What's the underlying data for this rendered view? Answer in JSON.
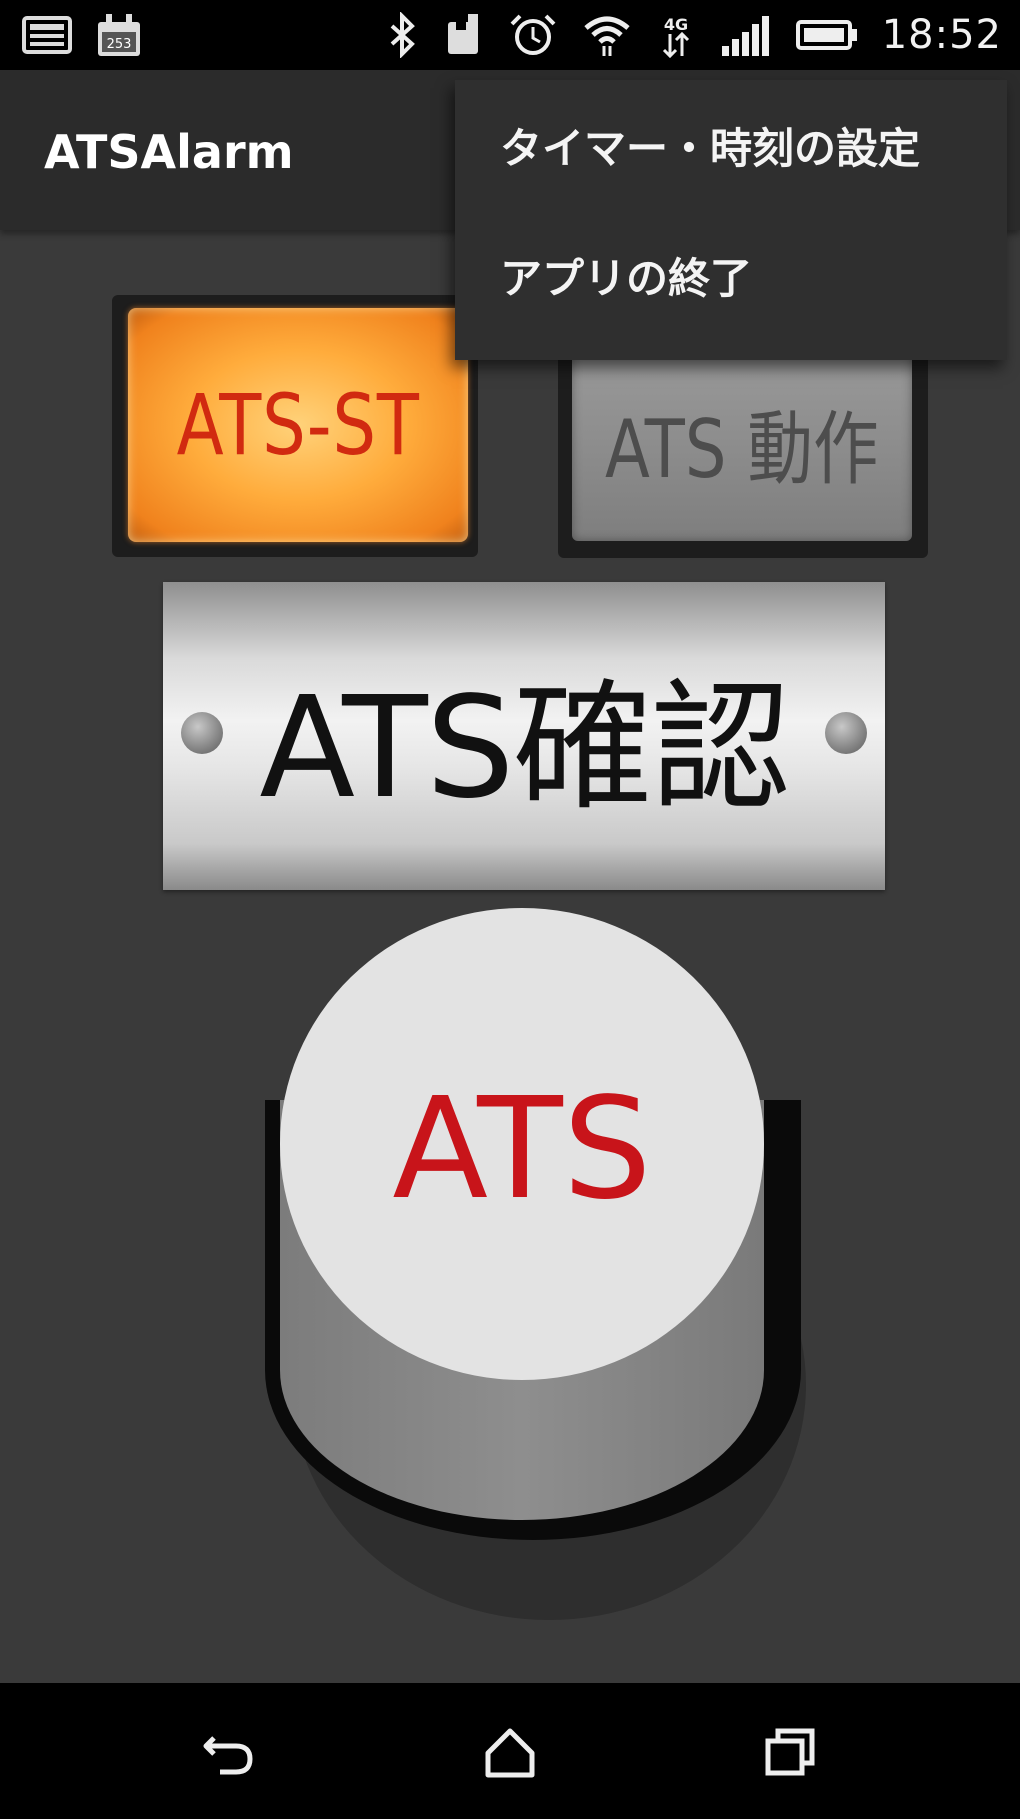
{
  "status_bar": {
    "time": "18:52",
    "left_icons": [
      "keyboard-notification-icon",
      "calendar-notification-icon"
    ],
    "right_icons": [
      "bluetooth-icon",
      "nfc-icon",
      "alarm-clock-icon",
      "wifi-icon",
      "mobile-data-icon",
      "signal-icon",
      "battery-icon"
    ]
  },
  "app": {
    "title": "ATSAlarm"
  },
  "overflow_menu": {
    "items": [
      {
        "label": "タイマー・時刻の設定"
      },
      {
        "label": "アプリの終了"
      }
    ]
  },
  "panel": {
    "lamp_st_label": "ATS-ST",
    "lamp_operation_label": "ATS 動作",
    "confirm_plate_label": "ATS確認",
    "button_label": "ATS"
  },
  "colors": {
    "lamp_st_lit": "#ffac3c",
    "lamp_st_text": "#d12a10",
    "lamp_operation_off": "#8d8d8d",
    "button_text": "#c8141a",
    "background": "#3a3a3a"
  },
  "nav_bar": {
    "icons": [
      "back-icon",
      "home-icon",
      "recent-apps-icon"
    ]
  }
}
